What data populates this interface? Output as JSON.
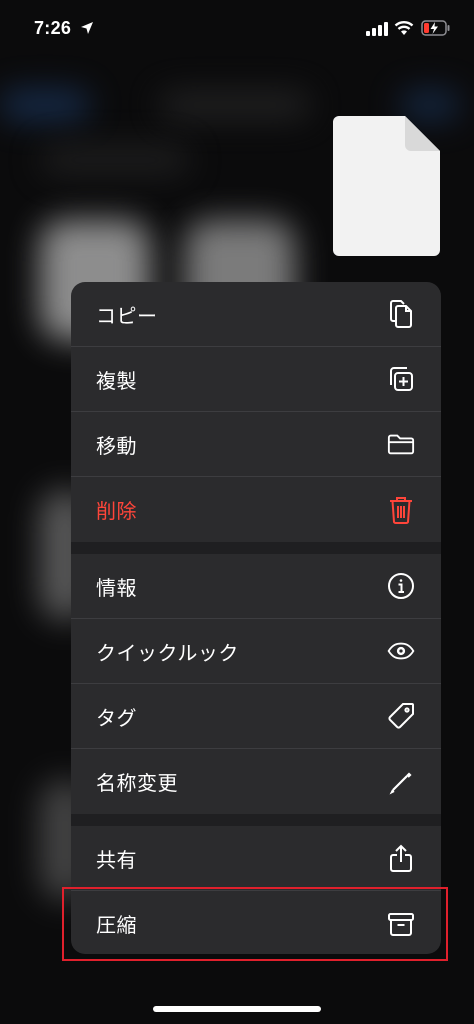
{
  "status_bar": {
    "time": "7:26"
  },
  "menu": {
    "groups": [
      {
        "items": [
          {
            "label": "コピー",
            "icon": "copy-icon"
          },
          {
            "label": "複製",
            "icon": "duplicate-icon"
          },
          {
            "label": "移動",
            "icon": "folder-icon"
          },
          {
            "label": "削除",
            "icon": "trash-icon",
            "destructive": true
          }
        ]
      },
      {
        "items": [
          {
            "label": "情報",
            "icon": "info-icon"
          },
          {
            "label": "クイックルック",
            "icon": "eye-icon"
          },
          {
            "label": "タグ",
            "icon": "tag-icon"
          },
          {
            "label": "名称変更",
            "icon": "pencil-icon"
          }
        ]
      },
      {
        "items": [
          {
            "label": "共有",
            "icon": "share-icon"
          },
          {
            "label": "圧縮",
            "icon": "archive-icon"
          }
        ]
      }
    ]
  },
  "colors": {
    "destructive": "#ff453a",
    "menu_bg": "#2b2b2d",
    "highlight_box": "#e0202c",
    "battery_low": "#ff3b30"
  }
}
